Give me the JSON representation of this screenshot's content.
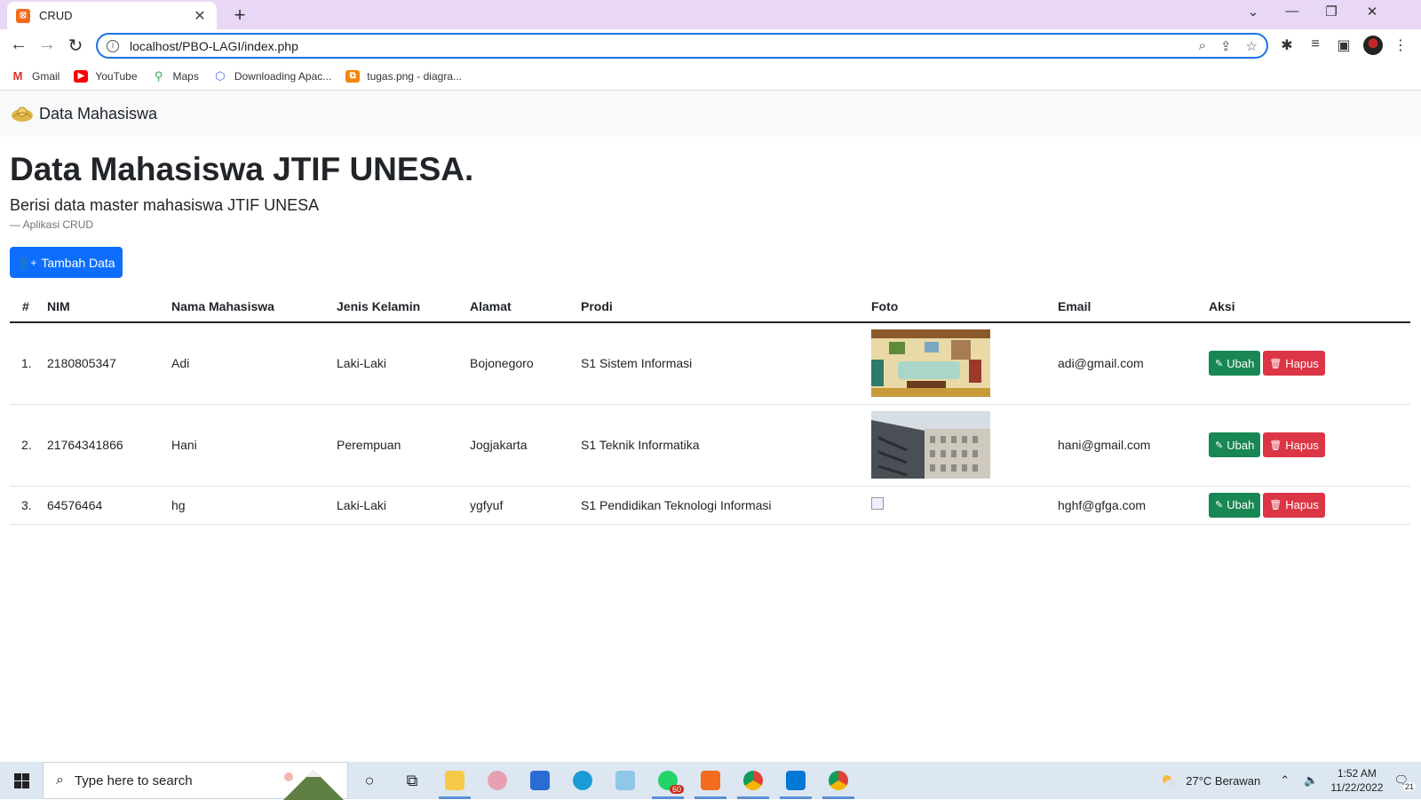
{
  "browser": {
    "tab_title": "CRUD",
    "tab_icon": "xampp-favicon",
    "url": "localhost/PBO-LAGI/index.php",
    "bookmarks": [
      {
        "label": "Gmail",
        "icon": "gmail-icon",
        "color": "#d93025"
      },
      {
        "label": "YouTube",
        "icon": "youtube-icon",
        "color": "#ff0000"
      },
      {
        "label": "Maps",
        "icon": "maps-icon",
        "color": "#34a853"
      },
      {
        "label": "Downloading Apac...",
        "icon": "apache-icon",
        "color": "#4a6cf7"
      },
      {
        "label": "tugas.png - diagra...",
        "icon": "drawio-icon",
        "color": "#f08705"
      }
    ]
  },
  "page": {
    "brand": "Data Mahasiswa",
    "title": "Data Mahasiswa JTIF UNESA.",
    "lead": "Berisi data master mahasiswa JTIF UNESA",
    "cite": "— Aplikasi CRUD",
    "add_button": "Tambah Data",
    "accent_color": "#0d6efd"
  },
  "table": {
    "headers": [
      "#",
      "NIM",
      "Nama Mahasiswa",
      "Jenis Kelamin",
      "Alamat",
      "Prodi",
      "Foto",
      "Email",
      "Aksi"
    ],
    "rows": [
      {
        "no": "1.",
        "nim": "2180805347",
        "nama": "Adi",
        "jk": "Laki-Laki",
        "alamat": "Bojonegoro",
        "prodi": "S1 Sistem Informasi",
        "foto": "living-room-photo",
        "email": "adi@gmail.com"
      },
      {
        "no": "2.",
        "nim": "21764341866",
        "nama": "Hani",
        "jk": "Perempuan",
        "alamat": "Jogjakarta",
        "prodi": "S1 Teknik Informatika",
        "foto": "building-photo",
        "email": "hani@gmail.com"
      },
      {
        "no": "3.",
        "nim": "64576464",
        "nama": "hg",
        "jk": "Laki-Laki",
        "alamat": "ygfyuf",
        "prodi": "S1 Pendidikan Teknologi Informasi",
        "foto": "broken-image",
        "email": "hghf@gfga.com"
      }
    ],
    "edit_label": "Ubah",
    "delete_label": "Hapus"
  },
  "taskbar": {
    "search_placeholder": "Type here to search",
    "weather": "27°C  Berawan",
    "time": "1:52 AM",
    "date": "11/22/2022",
    "whatsapp_badge": "60",
    "notification_count": "21"
  }
}
